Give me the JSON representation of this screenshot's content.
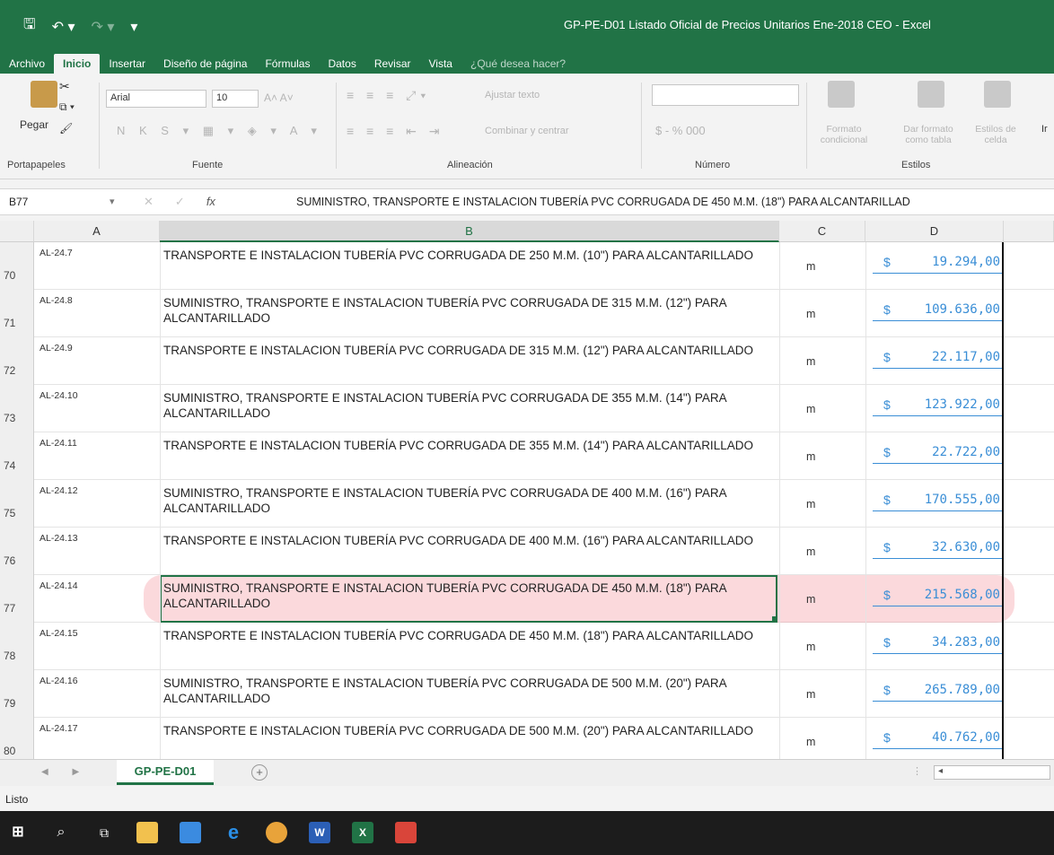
{
  "window": {
    "title": "GP-PE-D01 Listado Oficial de Precios Unitarios Ene-2018 CEO - Excel"
  },
  "tabs": [
    "Archivo",
    "Inicio",
    "Insertar",
    "Diseño de página",
    "Fórmulas",
    "Datos",
    "Revisar",
    "Vista",
    "¿Qué desea hacer?"
  ],
  "ribbon": {
    "paste_label": "Pegar",
    "font_name": "Arial",
    "font_size": "10",
    "wrap_text": "Ajustar texto",
    "merge_center": "Combinar y centrar",
    "number_format": "$ - % 000",
    "cond_format": "Formato condicional",
    "format_table": "Dar formato como tabla",
    "cell_styles": "Estilos de celda",
    "insert_partial": "Ir",
    "groups": [
      "Portapapeles",
      "Fuente",
      "Alineación",
      "Número",
      "Estilos"
    ]
  },
  "formula_bar": {
    "name_box": "B77",
    "fx": "fx",
    "content": "SUMINISTRO, TRANSPORTE E INSTALACION TUBERÍA PVC CORRUGADA DE 450 M.M. (18\") PARA ALCANTARILLAD"
  },
  "columns": [
    "A",
    "B",
    "C",
    "D"
  ],
  "rows": [
    {
      "num": "70",
      "code": "AL-24.7",
      "desc": "TRANSPORTE E INSTALACION TUBERÍA PVC CORRUGADA DE 250 M.M. (10\") PARA ALCANTARILLADO",
      "unit": "m",
      "currency": "$",
      "value": "19.294,00"
    },
    {
      "num": "71",
      "code": "AL-24.8",
      "desc": "SUMINISTRO, TRANSPORTE E INSTALACION TUBERÍA PVC CORRUGADA DE 315 M.M. (12\") PARA ALCANTARILLADO",
      "unit": "m",
      "currency": "$",
      "value": "109.636,00"
    },
    {
      "num": "72",
      "code": "AL-24.9",
      "desc": "TRANSPORTE E INSTALACION TUBERÍA PVC CORRUGADA DE 315 M.M. (12\") PARA ALCANTARILLADO",
      "unit": "m",
      "currency": "$",
      "value": "22.117,00"
    },
    {
      "num": "73",
      "code": "AL-24.10",
      "desc": "SUMINISTRO, TRANSPORTE E INSTALACION TUBERÍA PVC CORRUGADA DE 355 M.M. (14\") PARA ALCANTARILLADO",
      "unit": "m",
      "currency": "$",
      "value": "123.922,00"
    },
    {
      "num": "74",
      "code": "AL-24.11",
      "desc": "TRANSPORTE E INSTALACION TUBERÍA PVC CORRUGADA DE 355 M.M. (14\") PARA ALCANTARILLADO",
      "unit": "m",
      "currency": "$",
      "value": "22.722,00"
    },
    {
      "num": "75",
      "code": "AL-24.12",
      "desc": "SUMINISTRO, TRANSPORTE E INSTALACION TUBERÍA PVC CORRUGADA DE 400 M.M. (16\") PARA ALCANTARILLADO",
      "unit": "m",
      "currency": "$",
      "value": "170.555,00"
    },
    {
      "num": "76",
      "code": "AL-24.13",
      "desc": "TRANSPORTE E INSTALACION TUBERÍA PVC CORRUGADA DE 400 M.M. (16\") PARA ALCANTARILLADO",
      "unit": "m",
      "currency": "$",
      "value": "32.630,00"
    },
    {
      "num": "77",
      "code": "AL-24.14",
      "desc": "SUMINISTRO, TRANSPORTE E INSTALACION TUBERÍA PVC CORRUGADA DE 450 M.M. (18\") PARA ALCANTARILLADO",
      "unit": "m",
      "currency": "$",
      "value": "215.568,00"
    },
    {
      "num": "78",
      "code": "AL-24.15",
      "desc": "TRANSPORTE E INSTALACION TUBERÍA PVC CORRUGADA DE 450 M.M. (18\") PARA ALCANTARILLADO",
      "unit": "m",
      "currency": "$",
      "value": "34.283,00"
    },
    {
      "num": "79",
      "code": "AL-24.16",
      "desc": "SUMINISTRO, TRANSPORTE E INSTALACION TUBERÍA PVC CORRUGADA DE 500 M.M. (20\") PARA ALCANTARILLADO",
      "unit": "m",
      "currency": "$",
      "value": "265.789,00"
    },
    {
      "num": "80",
      "code": "AL-24.17",
      "desc": "TRANSPORTE E INSTALACION TUBERÍA PVC CORRUGADA DE 500 M.M. (20\") PARA ALCANTARILLADO",
      "unit": "m",
      "currency": "$",
      "value": "40.762,00"
    }
  ],
  "selected_row_index": 7,
  "sheet_tab": "GP-PE-D01",
  "status": "Listo",
  "colors": {
    "excel_green": "#217346",
    "value_blue": "#3a8ed6",
    "highlight": "#f07882"
  },
  "taskbar_icons": [
    "windows-start-icon",
    "search-icon",
    "task-view-icon",
    "file-explorer-icon",
    "store-icon",
    "edge-icon",
    "chrome-icon",
    "word-icon",
    "excel-icon",
    "acrobat-icon"
  ]
}
